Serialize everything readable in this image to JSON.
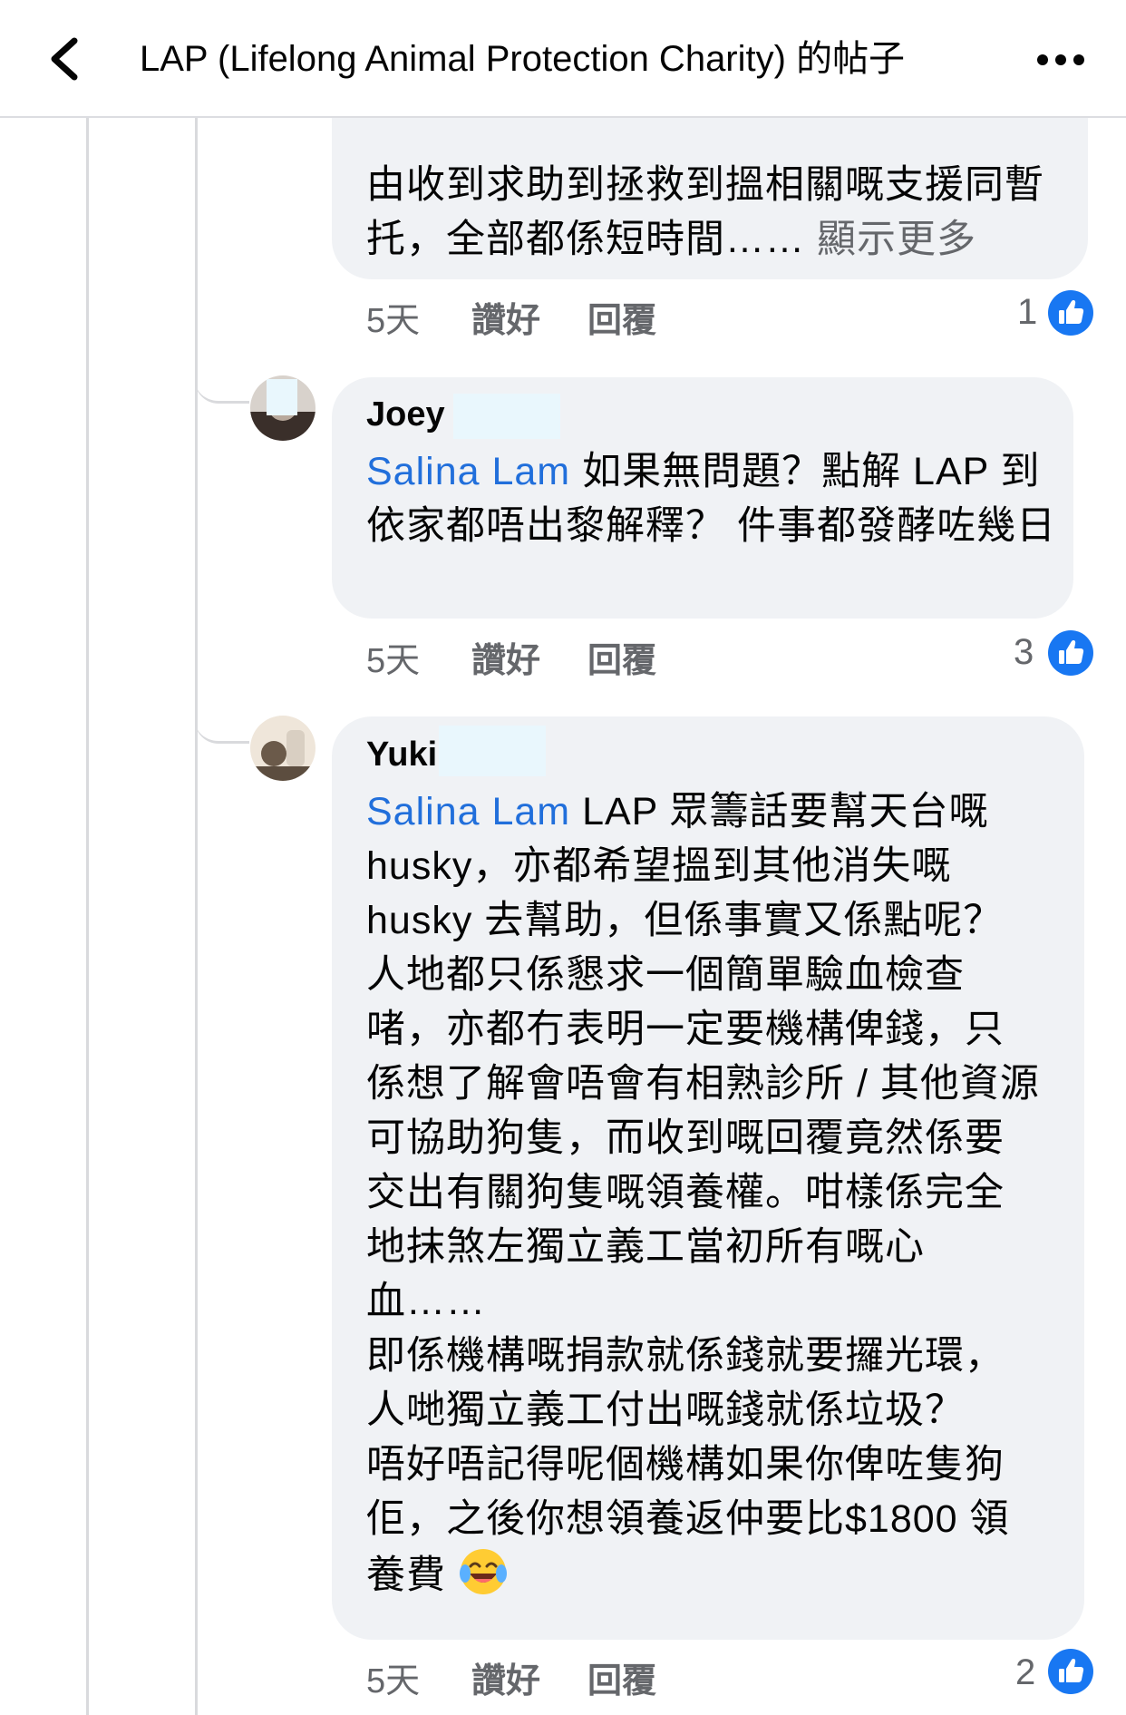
{
  "header": {
    "title": "LAP (Lifelong Animal Protection Charity) 的帖子",
    "back_icon": "chevron-left-icon",
    "more_icon": "more-horizontal-icon"
  },
  "comments": [
    {
      "text": "由收到求助到拯救到搵相關嘅支援同暫托，全部都係短時間……",
      "see_more": "顯示更多",
      "time": "5天",
      "like_label": "讚好",
      "reply_label": "回覆",
      "like_count": "1"
    },
    {
      "author": "Joey",
      "mention": "Salina Lam",
      "text": " 如果無問題？點解 LAP 到依家都唔出黎解釋？ 件事都發酵咗幾日",
      "time": "5天",
      "like_label": "讚好",
      "reply_label": "回覆",
      "like_count": "3"
    },
    {
      "author": "Yuki",
      "mention": "Salina Lam",
      "lines": [
        " LAP 眾籌話要幫天台嘅",
        "husky，亦都希望搵到其他消失嘅",
        "husky 去幫助，但係事實又係點呢？",
        "人地都只係懇求一個簡單驗血檢查",
        "啫，亦都冇表明一定要機構俾錢，只",
        "係想了解會唔會有相熟診所 / 其他資源",
        "可協助狗隻，而收到嘅回覆竟然係要",
        "交出有關狗隻嘅領養權。咁樣係完全",
        "地抹煞左獨立義工當初所有嘅心",
        "血……",
        "即係機構嘅捐款就係錢就要攞光環，",
        "人哋獨立義工付出嘅錢就係垃圾？",
        "唔好唔記得呢個機構如果你俾咗隻狗",
        "佢，之後你想領養返仲要比$1800 領",
        "養費"
      ],
      "emoji": "laughing-tears-emoji",
      "time": "5天",
      "like_label": "讚好",
      "reply_label": "回覆",
      "like_count": "2"
    }
  ],
  "colors": {
    "mention": "#216fdb",
    "like_blue": "#1877f2",
    "bubble": "#f0f2f5",
    "meta": "#65676b"
  }
}
